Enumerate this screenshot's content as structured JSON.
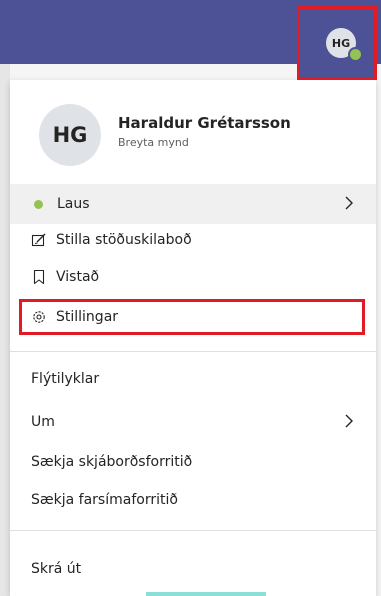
{
  "header": {
    "avatar_initials": "HG"
  },
  "profile": {
    "initials": "HG",
    "name": "Haraldur Grétarsson",
    "change_photo": "Breyta mynd"
  },
  "menu": {
    "status": "Laus",
    "set_status_message": "Stilla stöðuskilaboð",
    "saved": "Vistað",
    "settings": "Stillingar",
    "shortcuts": "Flýtilyklar",
    "about": "Um",
    "download_desktop": "Sækja skjáborðsforritið",
    "download_mobile": "Sækja farsímaforritið",
    "sign_out": "Skrá út"
  },
  "colors": {
    "header": "#4d5296",
    "available": "#92c353",
    "annotation": "#e01b24"
  },
  "icons": {
    "status": "presence-available-icon",
    "status_message": "edit-message-icon",
    "saved": "bookmark-icon",
    "settings": "gear-icon",
    "chevron": "chevron-right-icon"
  }
}
